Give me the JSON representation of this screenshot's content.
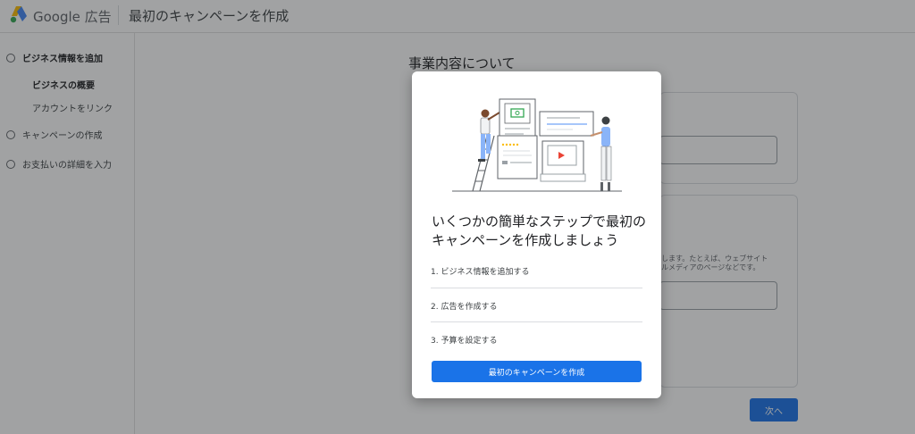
{
  "header": {
    "brand_name": "Google 広告",
    "page_title": "最初のキャンペーンを作成"
  },
  "sidebar": {
    "items": [
      {
        "label": "ビジネス情報を追加",
        "state": "current"
      },
      {
        "label": "ビジネスの概要",
        "state": "active-sub"
      },
      {
        "label": "アカウントをリンク",
        "state": "sub"
      },
      {
        "label": "キャンペーンの作成",
        "state": "pending"
      },
      {
        "label": "お支払いの詳細を入力",
        "state": "pending"
      }
    ]
  },
  "main": {
    "heading": "事業内容について",
    "help_text_line1": "します。たとえば、ウェブサイト",
    "help_text_line2": "ルメディアのページなどです。",
    "next_button": "次へ"
  },
  "modal": {
    "title": "いくつかの簡単なステップで最初のキャンペーンを作成しましょう",
    "steps": [
      "1. ビジネス情報を追加する",
      "2. 広告を作成する",
      "3. 予算を設定する"
    ],
    "primary_button": "最初のキャンペーンを作成"
  },
  "colors": {
    "primary": "#1a73e8",
    "overlay": "#202124"
  }
}
